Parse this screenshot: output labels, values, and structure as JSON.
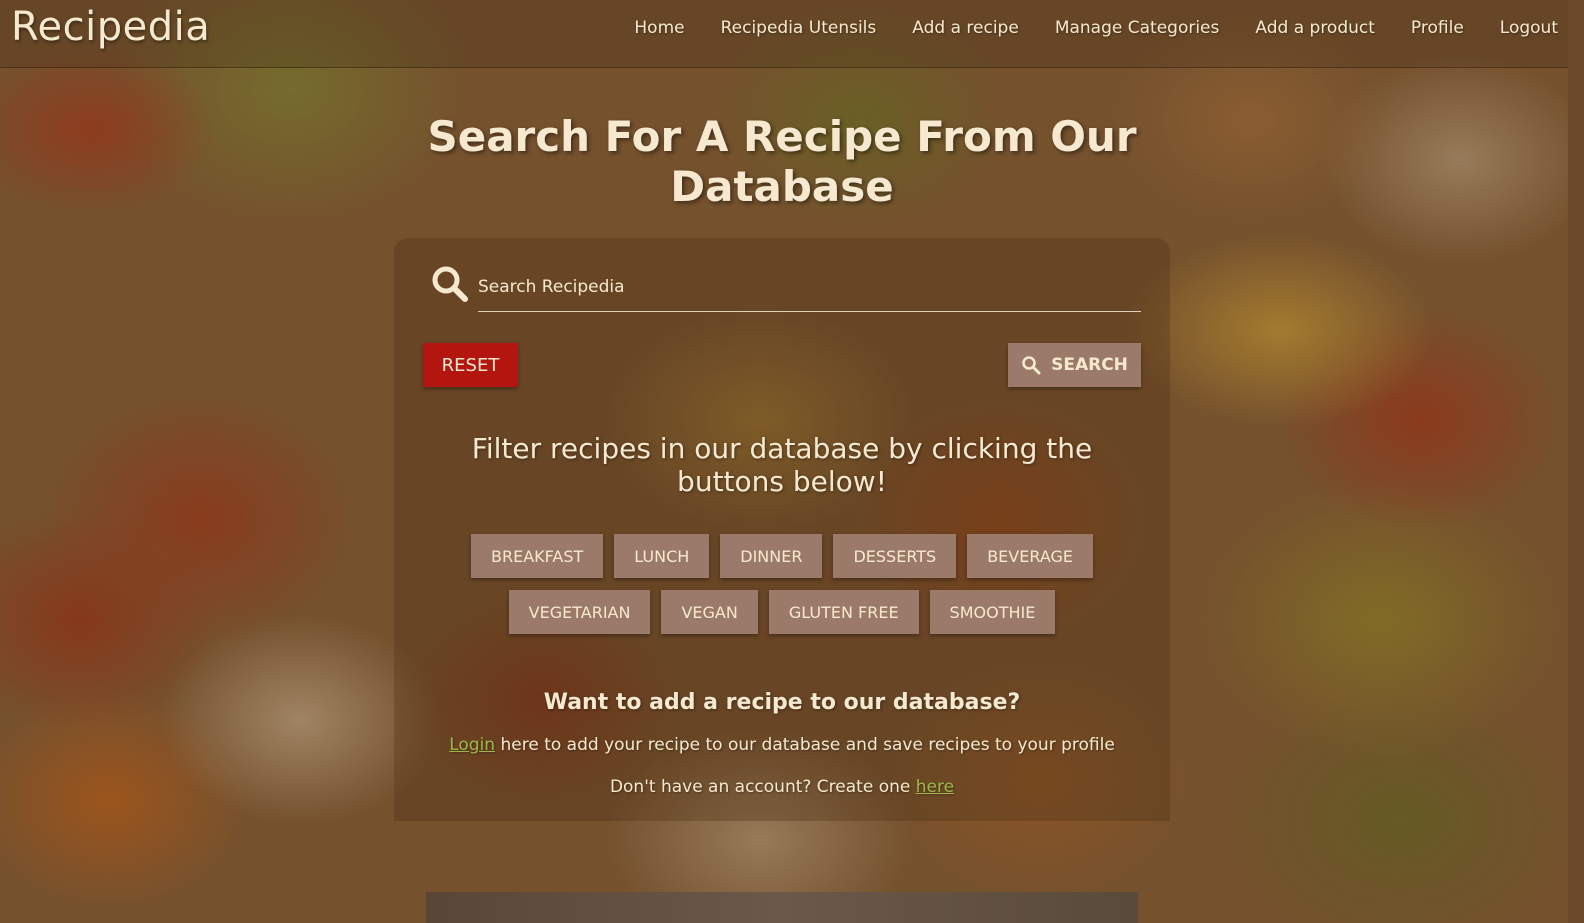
{
  "brand": "Recipedia",
  "nav": [
    "Home",
    "Recipedia Utensils",
    "Add a recipe",
    "Manage Categories",
    "Add a product",
    "Profile",
    "Logout"
  ],
  "hero_title": "Search For A Recipe From Our Database",
  "search": {
    "placeholder": "Search Recipedia",
    "icon": "search-icon"
  },
  "buttons": {
    "reset": "RESET",
    "search": "SEARCH"
  },
  "filter_heading": "Filter recipes in our database by clicking the buttons below!",
  "filters_row1": [
    "BREAKFAST",
    "LUNCH",
    "DINNER",
    "DESSERTS",
    "BEVERAGE"
  ],
  "filters_row2": [
    "VEGETARIAN",
    "VEGAN",
    "GLUTEN FREE",
    "SMOOTHIE"
  ],
  "add_recipe": {
    "heading": "Want to add a recipe to our database?",
    "login_link": "Login",
    "login_text": " here to add your recipe to our database and save recipes to your profile",
    "signup_text": "Don't have an account? Create one ",
    "signup_link": "here"
  },
  "colors": {
    "text": "#f6e9cf",
    "reset_button": "#b3160f",
    "chip_button": "#9c7a6a",
    "link": "#9ab84a"
  }
}
